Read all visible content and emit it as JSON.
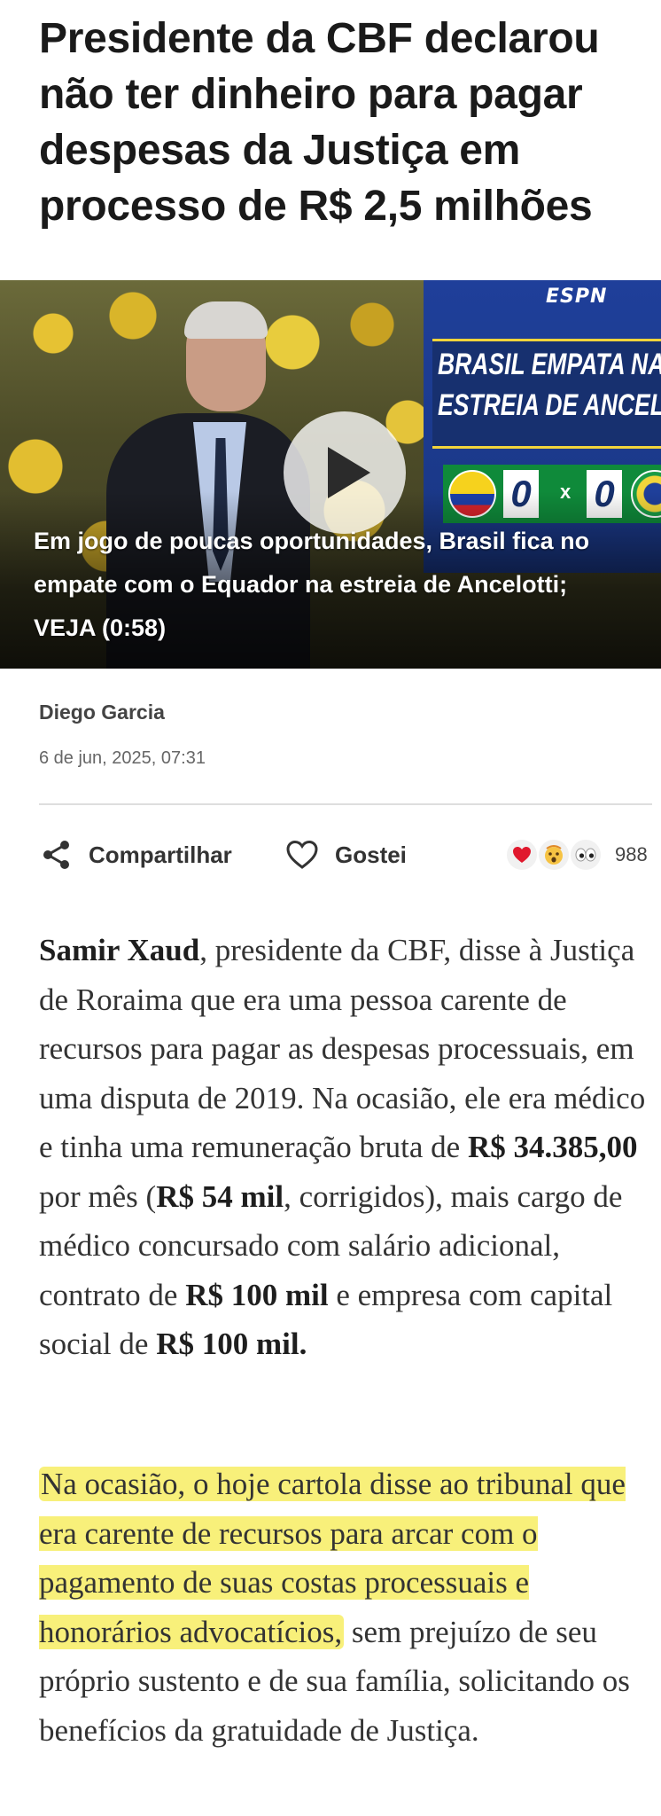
{
  "article": {
    "headline": "Presidente da CBF declarou não ter dinheiro para pagar despesas da Justiça em processo de R$ 2,5 milhões"
  },
  "video": {
    "caption": "Em jogo de poucas oportunidades, Brasil fica no empate com o Equador na estreia de Ancelotti; VEJA (0:58)",
    "overlay": {
      "logo": "ESPN",
      "headline_line1": "BRASIL EMPATA NA",
      "headline_line2": "ESTREIA DE ANCELOTT",
      "score_left": "0",
      "score_sep": "x",
      "score_right": "0"
    },
    "play_icon": "play-icon"
  },
  "meta": {
    "author": "Diego Garcia",
    "date": "6 de jun, 2025, 07:31"
  },
  "actions": {
    "share_label": "Compartilhar",
    "like_label": "Gostei",
    "reaction_icons": [
      "heart-icon",
      "surprised-face-icon",
      "eyes-icon"
    ],
    "reaction_count": "988"
  },
  "body": {
    "p1": [
      {
        "text": "Samir Xaud",
        "bold": true
      },
      {
        "text": ", presidente da CBF, disse à Justiça de Roraima que era uma pessoa carente de recursos para pagar as despesas processuais, em uma disputa de 2019. Na ocasião, ele era médico e tinha uma remuneração bruta de ",
        "bold": false
      },
      {
        "text": "R$ 34.385,00",
        "bold": true
      },
      {
        "text": " por mês (",
        "bold": false
      },
      {
        "text": "R$ 54 mil",
        "bold": true
      },
      {
        "text": ", corrigidos), mais cargo de médico concursado com salário adicional, contrato de ",
        "bold": false
      },
      {
        "text": "R$ 100 mil",
        "bold": true
      },
      {
        "text": " e empresa com capital social de ",
        "bold": false
      },
      {
        "text": "R$ 100 mil.",
        "bold": true
      }
    ],
    "p2_highlighted": "Na ocasião, o hoje cartola disse ao tribunal que era carente de recursos para arcar com o pagamento de suas costas processuais e honorários advocatícios,",
    "p2_rest": " sem prejuízo de seu próprio sustento e de sua família, solicitando os benefícios da gratuidade de Justiça."
  },
  "colors": {
    "highlight": "#f8f07a",
    "heart": "#e0182d",
    "espn_blue": "#1f3f9a"
  }
}
